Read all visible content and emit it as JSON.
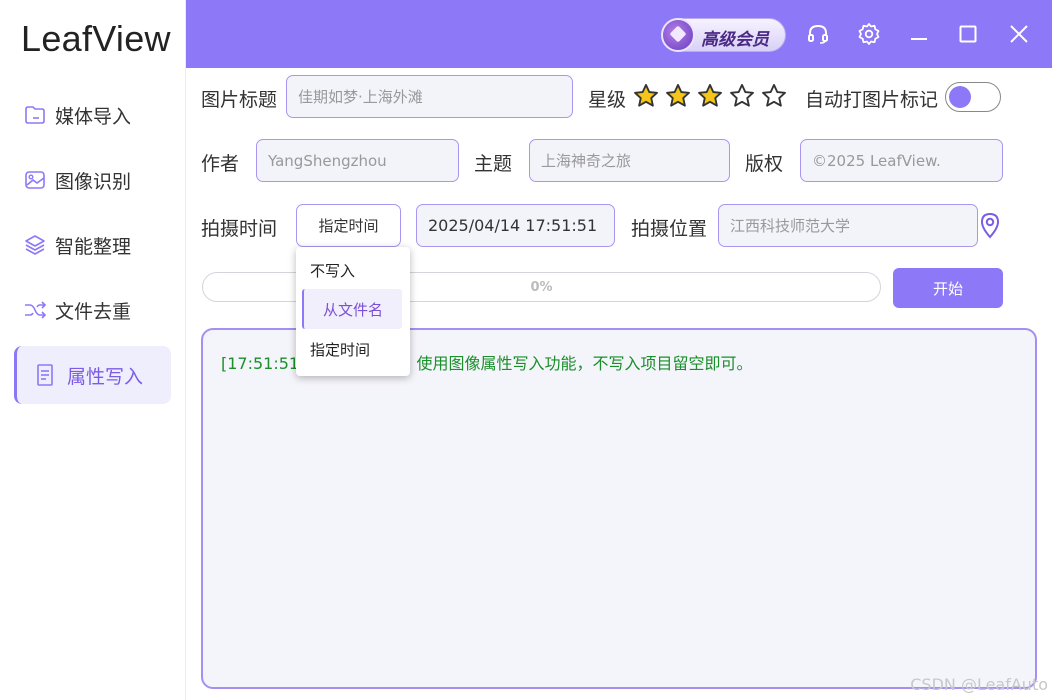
{
  "app": {
    "title": "LeafView"
  },
  "sidebar": {
    "items": [
      {
        "label": "媒体导入",
        "icon": "folder-icon",
        "active": false
      },
      {
        "label": "图像识别",
        "icon": "image-icon",
        "active": false
      },
      {
        "label": "智能整理",
        "icon": "layers-icon",
        "active": false
      },
      {
        "label": "文件去重",
        "icon": "shuffle-icon",
        "active": false
      },
      {
        "label": "属性写入",
        "icon": "document-icon",
        "active": true
      }
    ]
  },
  "titlebar": {
    "vip_label": "高级会员",
    "accent": "#8d78f7"
  },
  "form": {
    "image_title_label": "图片标题",
    "image_title_placeholder": "佳期如梦·上海外滩",
    "rating_label": "星级",
    "rating": 3,
    "rating_max": 5,
    "auto_mark_label": "自动打图片标记",
    "auto_mark_on": false,
    "author_label": "作者",
    "author_placeholder": "YangShengzhou",
    "subject_label": "主题",
    "subject_placeholder": "上海神奇之旅",
    "copyright_label": "版权",
    "copyright_placeholder": "©2025 LeafView.",
    "shoot_time_label": "拍摄时间",
    "shoot_time_mode": "指定时间",
    "shoot_time_value": "2025/04/14 17:51:51",
    "location_label": "拍摄位置",
    "location_placeholder": "江西科技师范大学"
  },
  "dropdown": {
    "options": [
      "不写入",
      "从文件名",
      "指定时间"
    ],
    "hovered": "从文件名"
  },
  "progress": {
    "value": 0,
    "label": "0%"
  },
  "start_button": "开始",
  "log": {
    "timestamp": "[17:51:51]",
    "message": "使用图像属性写入功能，不写入项目留空即可。"
  },
  "watermark": "CSDN @LeafAuto"
}
